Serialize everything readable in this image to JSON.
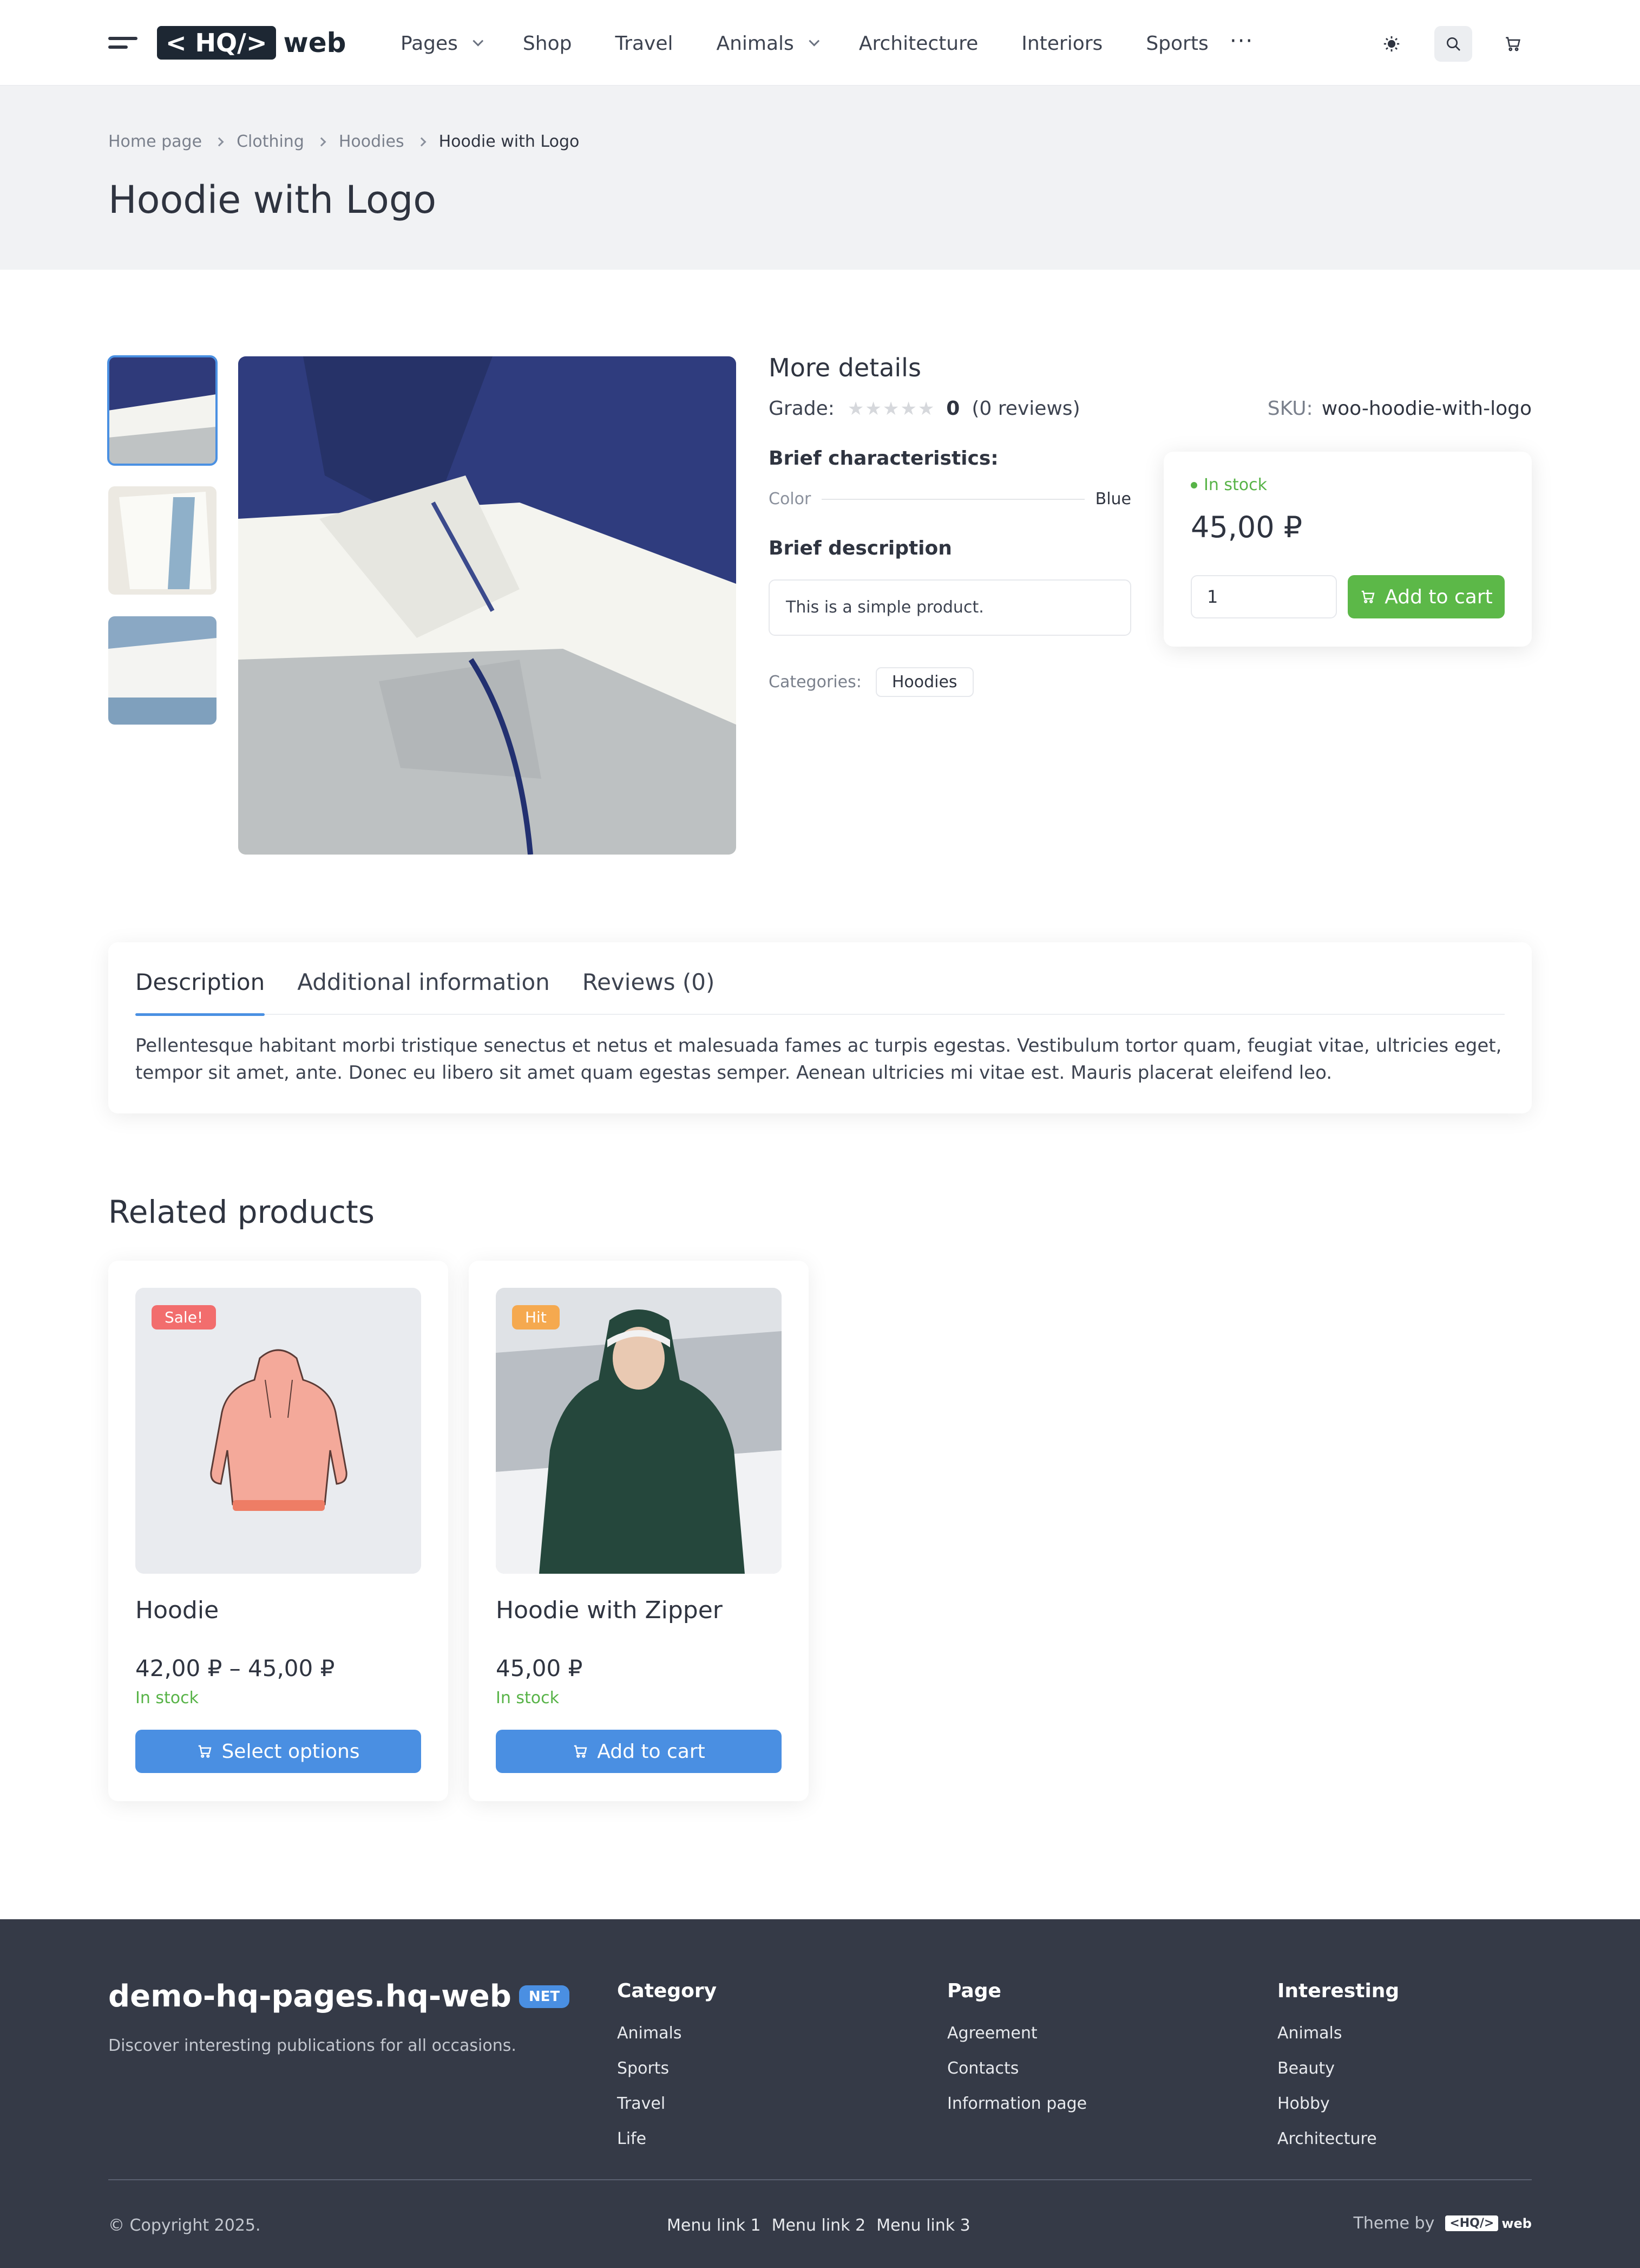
{
  "header": {
    "logo_box": "< HQ/>",
    "logo_text": "web",
    "nav": [
      {
        "label": "Pages",
        "dropdown": true
      },
      {
        "label": "Shop",
        "dropdown": false
      },
      {
        "label": "Travel",
        "dropdown": false
      },
      {
        "label": "Animals",
        "dropdown": true
      },
      {
        "label": "Architecture",
        "dropdown": false
      },
      {
        "label": "Interiors",
        "dropdown": false
      },
      {
        "label": "Sports",
        "dropdown": false
      }
    ],
    "more": "···",
    "icons": [
      "menu-icon",
      "sun-icon",
      "search-icon",
      "cart-icon"
    ]
  },
  "breadcrumb": [
    "Home page",
    "Clothing",
    "Hoodies",
    "Hoodie with Logo"
  ],
  "page_title": "Hoodie with Logo",
  "product": {
    "more_details": "More details",
    "grade_label": "Grade:",
    "stars": "★★★★★",
    "grade_value": "0",
    "reviews": "(0 reviews)",
    "sku_label": "SKU:",
    "sku": "woo-hoodie-with-logo",
    "characteristics_title": "Brief characteristics:",
    "color_label": "Color",
    "color_value": "Blue",
    "description_title": "Brief description",
    "short_description": "This is a simple product.",
    "categories_label": "Categories:",
    "category": "Hoodies",
    "stock": "In stock",
    "price": "45,00 ₽",
    "qty": "1",
    "add_to_cart": "Add to cart"
  },
  "tabs": {
    "items": [
      "Description",
      "Additional information",
      "Reviews (0)"
    ],
    "active": 0,
    "description": "Pellentesque habitant morbi tristique senectus et netus et malesuada fames ac turpis egestas. Vestibulum tortor quam, feugiat vitae, ultricies eget, tempor sit amet, ante. Donec eu libero sit amet quam egestas semper. Aenean ultricies mi vitae est. Mauris placerat eleifend leo."
  },
  "related": {
    "title": "Related products",
    "products": [
      {
        "badge": "Sale!",
        "badge_color": "#f26d6d",
        "name": "Hoodie",
        "price": "42,00 ₽ – 45,00 ₽",
        "stock": "In stock",
        "button": "Select options"
      },
      {
        "badge": "Hit",
        "badge_color": "#f5a94f",
        "name": "Hoodie with Zipper",
        "price": "45,00 ₽",
        "stock": "In stock",
        "button": "Add to cart"
      }
    ]
  },
  "footer": {
    "site_name": "demo-hq-pages.hq-web",
    "site_badge": "NET",
    "tagline": "Discover interesting publications for all occasions.",
    "columns": [
      {
        "title": "Category",
        "links": [
          "Animals",
          "Sports",
          "Travel",
          "Life"
        ]
      },
      {
        "title": "Page",
        "links": [
          "Agreement",
          "Contacts",
          "Information page"
        ]
      },
      {
        "title": "Interesting",
        "links": [
          "Animals",
          "Beauty",
          "Hobby",
          "Architecture"
        ]
      }
    ],
    "copyright": "© Copyright 2025.",
    "menu_links": [
      "Menu link 1",
      "Menu link 2",
      "Menu link 3"
    ],
    "theme_by": "Theme by",
    "theme_logo_box": "<HQ/>",
    "theme_logo_text": "web"
  },
  "colors": {
    "accent_blue": "#4a8fe2",
    "green": "#5cb848",
    "footer_bg": "#353a47",
    "title_band": "#f1f2f4"
  }
}
